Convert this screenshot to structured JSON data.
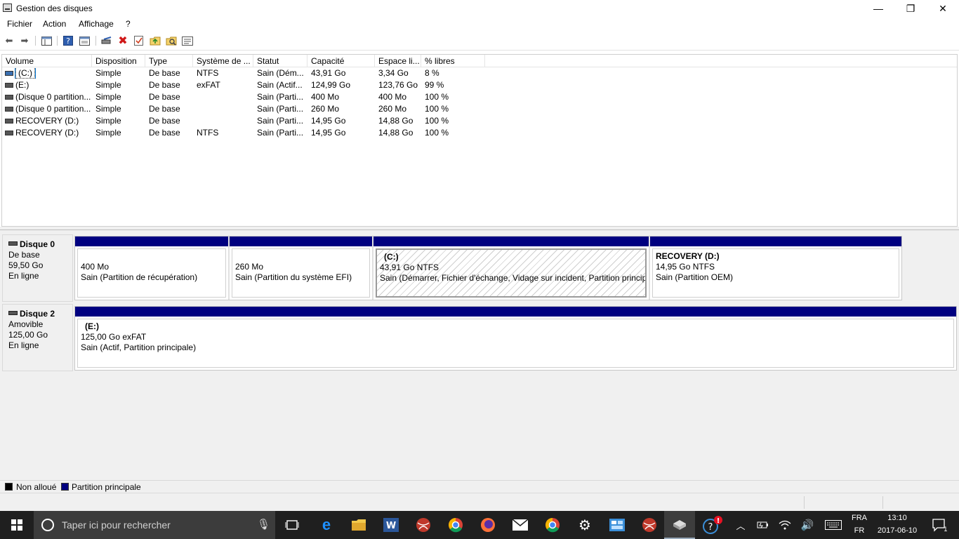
{
  "window": {
    "title": "Gestion des disques",
    "minimize_glyph": "—",
    "maximize_glyph": "❐",
    "close_glyph": "✕"
  },
  "menu": [
    "Fichier",
    "Action",
    "Affichage",
    "?"
  ],
  "toolbar_icons": [
    "back-arrow-icon",
    "forward-arrow-icon",
    "console-tree-icon",
    "help-icon",
    "properties-icon",
    "connect-icon",
    "delete-icon",
    "check-icon",
    "folder-up-icon",
    "search-folder-icon",
    "list-icon"
  ],
  "volume_list": {
    "columns": [
      "Volume",
      "Disposition",
      "Type",
      "Système de ...",
      "Statut",
      "Capacité",
      "Espace li...",
      "% libres"
    ],
    "rows": [
      {
        "volume": "(C:)",
        "disposition": "Simple",
        "type": "De base",
        "fs": "NTFS",
        "status": "Sain (Dém...",
        "capacity": "43,91 Go",
        "free": "3,34 Go",
        "pct": "8 %",
        "selected": true
      },
      {
        "volume": "(E:)",
        "disposition": "Simple",
        "type": "De base",
        "fs": "exFAT",
        "status": "Sain (Actif...",
        "capacity": "124,99 Go",
        "free": "123,76 Go",
        "pct": "99 %"
      },
      {
        "volume": "(Disque 0 partition...",
        "disposition": "Simple",
        "type": "De base",
        "fs": "",
        "status": "Sain (Parti...",
        "capacity": "400 Mo",
        "free": "400 Mo",
        "pct": "100 %"
      },
      {
        "volume": "(Disque 0 partition...",
        "disposition": "Simple",
        "type": "De base",
        "fs": "",
        "status": "Sain (Parti...",
        "capacity": "260 Mo",
        "free": "260 Mo",
        "pct": "100 %"
      },
      {
        "volume": "RECOVERY (D:)",
        "disposition": "Simple",
        "type": "De base",
        "fs": "",
        "status": "Sain (Parti...",
        "capacity": "14,95 Go",
        "free": "14,88 Go",
        "pct": "100 %"
      },
      {
        "volume": "RECOVERY (D:)",
        "disposition": "Simple",
        "type": "De base",
        "fs": "NTFS",
        "status": "Sain (Parti...",
        "capacity": "14,95 Go",
        "free": "14,88 Go",
        "pct": "100 %"
      }
    ]
  },
  "disks": [
    {
      "name": "Disque 0",
      "kind": "De base",
      "size": "59,50 Go",
      "state": "En ligne",
      "partitions": [
        {
          "name": "",
          "size": "400 Mo",
          "status": "Sain (Partition de récupération)"
        },
        {
          "name": "",
          "size": "260 Mo",
          "status": "Sain (Partition du système EFI)"
        },
        {
          "name": "(C:)",
          "size": "43,91 Go NTFS",
          "status": "Sain (Démarrer, Fichier d'échange, Vidage sur incident, Partition principale)",
          "selected": true
        },
        {
          "name": "RECOVERY  (D:)",
          "size": "14,95 Go NTFS",
          "status": "Sain (Partition OEM)"
        }
      ]
    },
    {
      "name": "Disque 2",
      "kind": "Amovible",
      "size": "125,00 Go",
      "state": "En ligne",
      "partitions": [
        {
          "name": "(E:)",
          "size": "125,00 Go exFAT",
          "status": "Sain (Actif, Partition principale)"
        }
      ]
    }
  ],
  "legend": [
    {
      "label": "Non alloué",
      "color": "#000000"
    },
    {
      "label": "Partition principale",
      "color": "#000080"
    }
  ],
  "taskbar": {
    "search_placeholder": "Taper ici pour rechercher",
    "lang_top": "FRA",
    "lang_bottom": "FR",
    "time": "13:10",
    "date": "2017-06-10",
    "notification_count": "1",
    "pinned_icons": [
      "task-view-icon",
      "edge-icon",
      "file-explorer-icon",
      "word-icon",
      "app-red-icon",
      "chrome-icon",
      "firefox-icon",
      "mail-icon",
      "chrome-alt-icon",
      "settings-icon",
      "control-panel-icon",
      "app-red-2-icon",
      "disk-management-icon",
      "help-alert-icon"
    ]
  }
}
